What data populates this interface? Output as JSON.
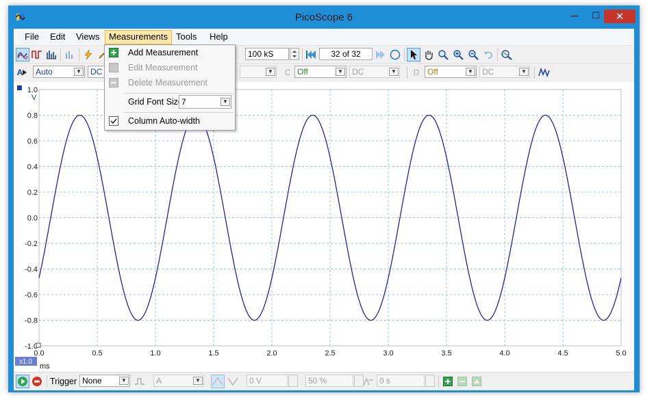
{
  "window": {
    "title": "PicoScope 6",
    "minimize": "—",
    "maximize": "☐",
    "close": "✕"
  },
  "menubar": {
    "items": [
      {
        "label": "File"
      },
      {
        "label": "Edit"
      },
      {
        "label": "Views"
      },
      {
        "label": "Measurements"
      },
      {
        "label": "Tools"
      },
      {
        "label": "Help"
      }
    ]
  },
  "toolbar1": {
    "samples_value": "100 kS",
    "buffer_value": "32 of 32"
  },
  "toolbar2": {
    "channel_a_label": "A",
    "channel_a_range": "Auto",
    "channel_a_coupling": "DC",
    "channel_b_coupling": "",
    "channel_c_label": "C",
    "channel_c_range": "Off",
    "channel_c_coupling": "DC",
    "channel_d_label": "D",
    "channel_d_range": "Off",
    "channel_d_coupling": "DC"
  },
  "measurements_menu": {
    "add": "Add Measurement",
    "edit": "Edit Measurement",
    "delete": "Delete Measurement",
    "grid_font_label": "Grid Font Size",
    "grid_font_value": "7",
    "column_autowidth": "Column Auto-width"
  },
  "chart_data": {
    "type": "line",
    "y_unit": "V",
    "x_unit": "ms",
    "zoom_label": "x1.0",
    "xlim": [
      0.0,
      5.0
    ],
    "ylim": [
      -1.0,
      1.0
    ],
    "x_ticks": [
      "0.0",
      "0.5",
      "1.0",
      "1.5",
      "2.0",
      "2.5",
      "3.0",
      "3.5",
      "4.0",
      "4.5",
      "5.0"
    ],
    "y_ticks": [
      "1.0",
      "0.8",
      "0.6",
      "0.4",
      "0.2",
      "0.0",
      "-0.2",
      "-0.4",
      "-0.6",
      "-0.8",
      "-1.0"
    ],
    "grid": true,
    "series": [
      {
        "amplitude": 0.8,
        "frequency_khz": 1.0,
        "phase_deg": -36,
        "color": "#1010b0"
      }
    ]
  },
  "statusbar": {
    "trigger_label": "Trigger",
    "trigger_mode": "None",
    "trigger_source": "A",
    "trigger_level": "0 V",
    "trigger_position": "50 %",
    "trigger_delay": "0 s"
  },
  "colors": {
    "channel_a": "#1010b0",
    "grid": "#9ec4de",
    "accent": "#1e8fd6"
  }
}
